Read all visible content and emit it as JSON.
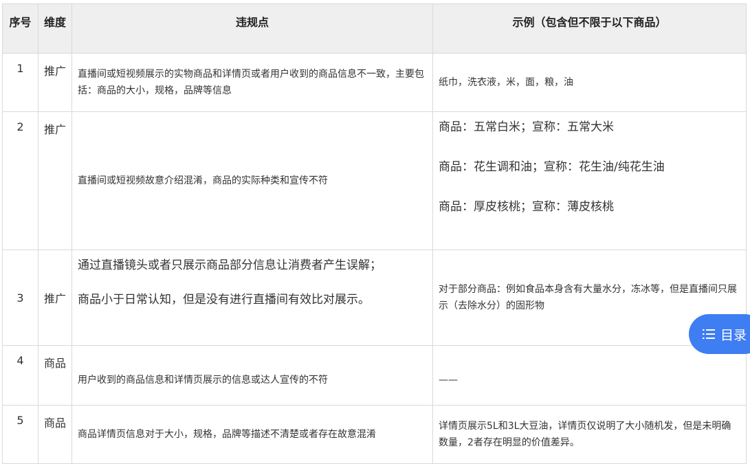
{
  "table": {
    "headers": [
      "序号",
      "维度",
      "违规点",
      "示例（包含但不限于以下商品）"
    ],
    "rows": [
      {
        "num": "1",
        "dimension": "推广",
        "violation": [
          "直播间或短视频展示的实物商品和详情页或者用户收到的商品信息不一致，主要包括：商品的大小，规格，品牌等信息"
        ],
        "example": [
          "纸巾，洗衣液，米，面，粮，油"
        ]
      },
      {
        "num": "2",
        "dimension": "推广",
        "violation": [
          "直播间或短视频故意介绍混淆，商品的实际种类和宣传不符"
        ],
        "example": [
          "商品：五常白米；宣称：五常大米",
          "商品：花生调和油；宣称：花生油/纯花生油",
          "商品：厚皮核桃；宣称：薄皮核桃"
        ]
      },
      {
        "num": "3",
        "dimension": "推广",
        "violation": [
          "通过直播镜头或者只展示商品部分信息让消费者产生误解；",
          "商品小于日常认知，但是没有进行直播间有效比对展示。"
        ],
        "example": [
          "对于部分商品：例如食品本身含有大量水分，冻冰等，但是直播间只展示（去除水分）的固形物"
        ]
      },
      {
        "num": "4",
        "dimension": "商品",
        "violation": [
          "用户收到的商品信息和详情页展示的信息或达人宣传的不符"
        ],
        "example": [
          "——"
        ]
      },
      {
        "num": "5",
        "dimension": "商品",
        "violation": [
          "商品详情页信息对于大小，规格，品牌等描述不清楚或者存在故意混淆"
        ],
        "example": [
          "详情页展示5L和3L大豆油，详情页仅说明了大小随机发，但是未明确数量，2者存在明显的价值差异。"
        ]
      }
    ]
  },
  "toc": {
    "label": "目录",
    "icon": "list-icon",
    "color": "#3f7df2"
  }
}
